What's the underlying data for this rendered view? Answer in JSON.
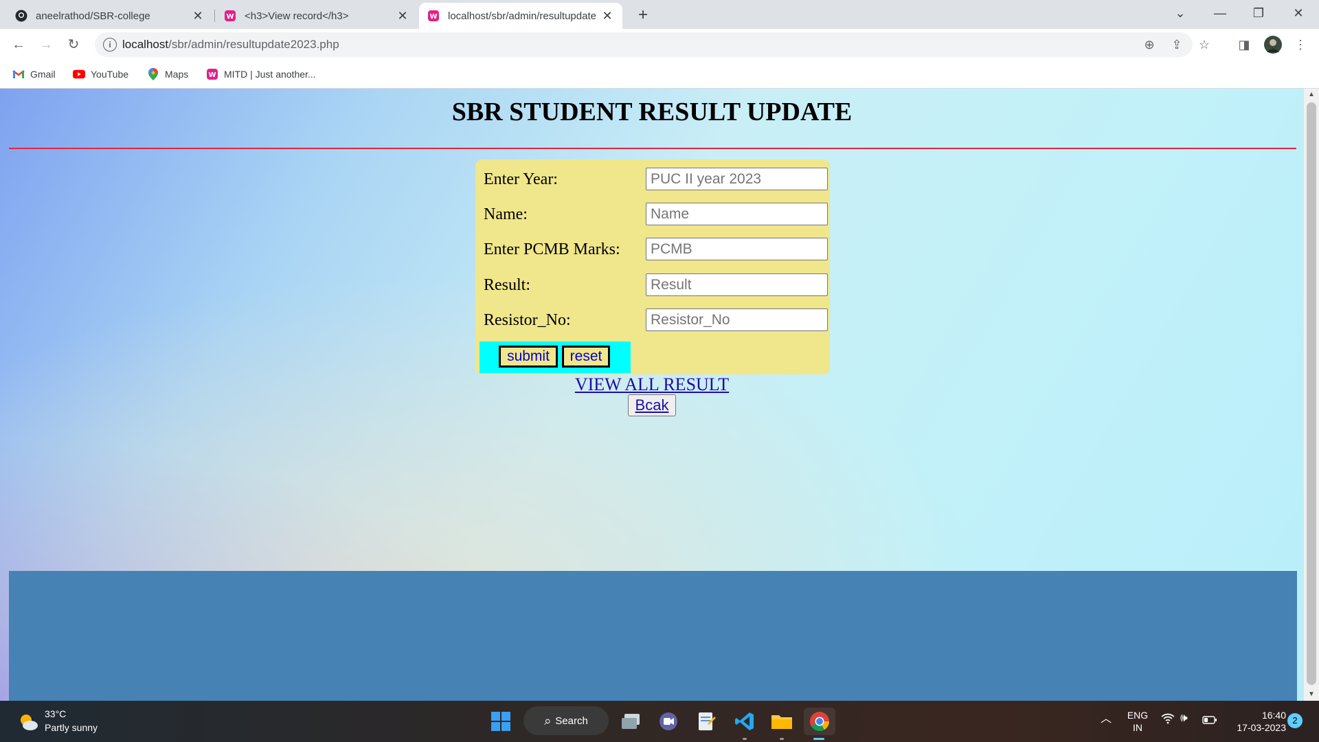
{
  "browser": {
    "tabs": [
      {
        "title": "aneelrathod/SBR-college",
        "icon": "github-icon"
      },
      {
        "title": "<h3>View record</h3>",
        "icon": "wampserver-icon"
      },
      {
        "title": "localhost/sbr/admin/resultupdate",
        "icon": "wampserver-icon"
      }
    ],
    "url_host": "localhost",
    "url_path": "/sbr/admin/resultupdate2023.php",
    "bookmarks": [
      {
        "label": "Gmail",
        "icon": "gmail-icon"
      },
      {
        "label": "YouTube",
        "icon": "youtube-icon"
      },
      {
        "label": "Maps",
        "icon": "maps-icon"
      },
      {
        "label": "MITD | Just another...",
        "icon": "wampserver-icon"
      }
    ]
  },
  "page": {
    "heading": "SBR STUDENT RESULT UPDATE",
    "form": {
      "fields": [
        {
          "label": "Enter Year:",
          "placeholder": "PUC II year 2023",
          "value": ""
        },
        {
          "label": "Name:",
          "placeholder": "Name",
          "value": ""
        },
        {
          "label": "Enter PCMB Marks:",
          "placeholder": "PCMB",
          "value": ""
        },
        {
          "label": "Result:",
          "placeholder": "Result",
          "value": ""
        },
        {
          "label": "Resistor_No:",
          "placeholder": "Resistor_No",
          "value": ""
        }
      ],
      "submit_label": "submit",
      "reset_label": "reset"
    },
    "view_all_link": "VIEW ALL RESULT",
    "back_button": "Bcak"
  },
  "colors": {
    "form_bg": "#f0e68c",
    "button_area_bg": "#00ffff",
    "footer_bg": "#4682b4",
    "divider": "#e0263f",
    "link": "#1a0dab"
  },
  "taskbar": {
    "weather_temp": "33°C",
    "weather_desc": "Partly sunny",
    "search_label": "Search",
    "lang_line1": "ENG",
    "lang_line2": "IN",
    "time": "16:40",
    "date": "17-03-2023",
    "notification_count": "2"
  }
}
